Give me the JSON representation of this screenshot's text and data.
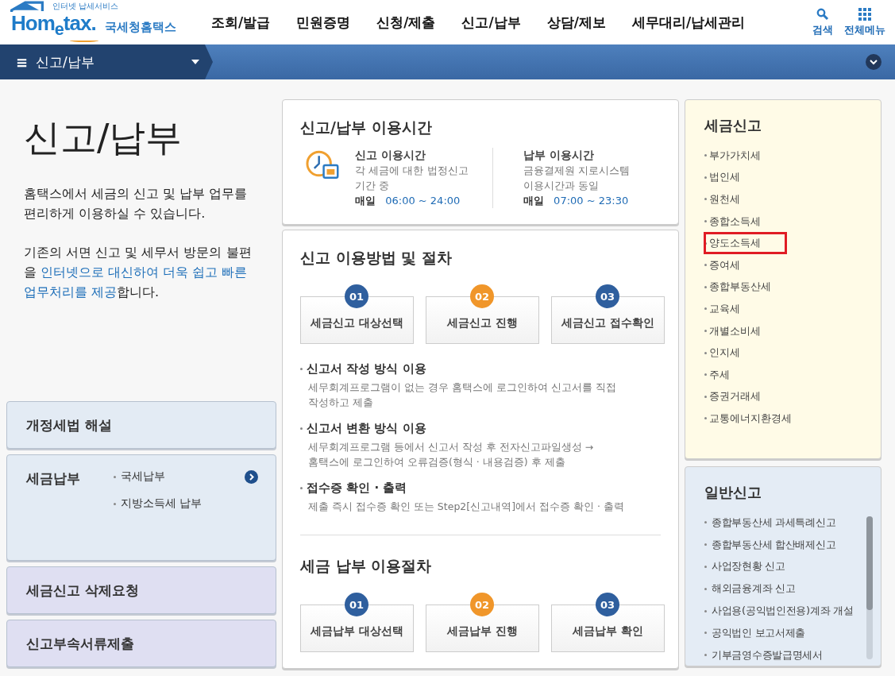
{
  "logo": {
    "tagline": "인터넷 납세서비스",
    "brand": "Hom$_{e}$tax.",
    "name": "국세청홈택스"
  },
  "main_menu": [
    {
      "label": "조회/발급",
      "selected": false
    },
    {
      "label": "민원증명",
      "selected": false
    },
    {
      "label": "신청/제출",
      "selected": false
    },
    {
      "label": "신고/납부",
      "selected": false
    },
    {
      "label": "상담/제보",
      "selected": false
    },
    {
      "label": "세무대리/납세관리",
      "selected": false
    }
  ],
  "header_tools": [
    {
      "kind": "search",
      "label": "검색"
    },
    {
      "kind": "grid",
      "label": "전체메뉴"
    }
  ],
  "breadcrumb": {
    "menu_icon": "≡",
    "label": "신고/납부"
  },
  "page_title": "신고/납부",
  "intro": [
    [
      {
        "text": "홈택스에서 세금의 신고 및 납부 업무를 편리하게 이용하실 수 있습니다.",
        "emphasis": false
      }
    ],
    [
      {
        "text": "기존의 서면 신고 및 세무서 방문의 불편을 ",
        "emphasis": false
      },
      {
        "text": "인터넷으로 대신하여 더욱 쉽고 빠른 업무처리를 제공",
        "emphasis": true
      },
      {
        "text": "합니다.",
        "emphasis": false
      }
    ]
  ],
  "side_cards": [
    {
      "title": "개정세법 해설",
      "kind": "guide"
    },
    {
      "title": "세금납부",
      "kind": "guide",
      "links": [
        {
          "label": "국세납부",
          "go": true
        },
        {
          "label": "지방소득세 납부",
          "go": false
        }
      ]
    },
    {
      "title": "세금신고 삭제요청",
      "kind": "request"
    },
    {
      "title": "신고부속서류제출",
      "kind": "request"
    }
  ],
  "hours": {
    "title": "신고/납부 이용시간",
    "columns": [
      {
        "heading": "신고 이용시간",
        "lines": [
          "각 세금에 대한 법정신고",
          "기간 중"
        ],
        "day": "매일",
        "time": "06:00 ~ 24:00"
      },
      {
        "heading": "납부 이용시간",
        "lines": [
          "금융결제원 지로시스템",
          "이용시간과 동일"
        ],
        "day": "매일",
        "time": "07:00 ~ 23:30"
      }
    ]
  },
  "filing": {
    "title": "신고 이용방법 및 절차",
    "steps": [
      {
        "number": "01",
        "label": "세금신고 대상선택",
        "color": "#2f5f9e"
      },
      {
        "number": "02",
        "label": "세금신고 진행",
        "color": "#f0962a"
      },
      {
        "number": "03",
        "label": "세금신고 접수확인",
        "color": "#2f5f9e"
      }
    ],
    "methods": [
      {
        "heading": "신고서 작성 방식 이용",
        "lines": [
          "세무회계프로그램이 없는 경우 홈택스에 로그인하여 신고서를 직접",
          "작성하고 제출"
        ]
      },
      {
        "heading": "신고서 변환 방식 이용",
        "lines": [
          "세무회계프로그램 등에서 신고서 작성 후 전자신고파일생성 →",
          "홈택스에 로그인하여 오류검증(형식 · 내용검증) 후 제출"
        ]
      },
      {
        "heading": "접수증 확인 · 출력",
        "lines": [
          "제출 즉시 접수증 확인 또는 Step2[신고내역]에서 접수증 확인 · 출력"
        ]
      }
    ]
  },
  "payment": {
    "title": "세금 납부 이용절차",
    "steps": [
      {
        "number": "01",
        "label": "세금납부 대상선택",
        "color": "#2f5f9e"
      },
      {
        "number": "02",
        "label": "세금납부 진행",
        "color": "#f0962a"
      },
      {
        "number": "03",
        "label": "세금납부 확인",
        "color": "#2f5f9e"
      }
    ]
  },
  "tax_filing": {
    "title": "세금신고",
    "items": [
      {
        "label": "부가가치세",
        "highlighted": false
      },
      {
        "label": "법인세",
        "highlighted": false
      },
      {
        "label": "원천세",
        "highlighted": false
      },
      {
        "label": "종합소득세",
        "highlighted": false
      },
      {
        "label": "양도소득세",
        "highlighted": true
      },
      {
        "label": "증여세",
        "highlighted": false
      },
      {
        "label": "종합부동산세",
        "highlighted": false
      },
      {
        "label": "교육세",
        "highlighted": false
      },
      {
        "label": "개별소비세",
        "highlighted": false
      },
      {
        "label": "인지세",
        "highlighted": false
      },
      {
        "label": "주세",
        "highlighted": false
      },
      {
        "label": "증권거래세",
        "highlighted": false
      },
      {
        "label": "교통에너지환경세",
        "highlighted": false
      }
    ]
  },
  "general_filing": {
    "title": "일반신고",
    "items": [
      "종합부동산세 과세특례신고",
      "종합부동산세 합산배제신고",
      "사업장현황 신고",
      "해외금융계좌 신고",
      "사업용(공익법인전용)계좌 개설",
      "공익법인 보고서제출",
      "기부금영수증발급명세서"
    ]
  }
}
